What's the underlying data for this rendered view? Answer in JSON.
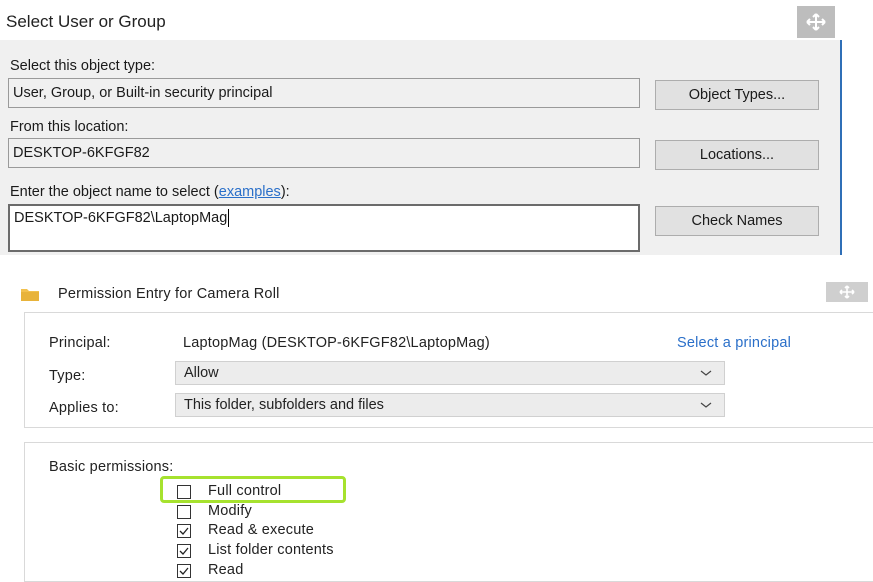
{
  "select_dialog": {
    "title": "Select User or Group",
    "object_type_label": "Select this object type:",
    "object_type_value": "User, Group, or Built-in security principal",
    "object_types_button": "Object Types...",
    "location_label": "From this location:",
    "location_value": "DESKTOP-6KFGF82",
    "locations_button": "Locations...",
    "enter_name_label_prefix": "Enter the object name to select (",
    "enter_name_link": "examples",
    "enter_name_label_suffix": "):",
    "object_name_value": "DESKTOP-6KFGF82\\LaptopMag",
    "check_names_button": "Check Names"
  },
  "permission_dialog": {
    "title": "Permission Entry for Camera Roll",
    "principal_label": "Principal:",
    "principal_value": "LaptopMag (DESKTOP-6KFGF82\\LaptopMag)",
    "select_principal_link": "Select a principal",
    "type_label": "Type:",
    "type_value": "Allow",
    "applies_to_label": "Applies to:",
    "applies_to_value": "This folder, subfolders and files",
    "basic_permissions_label": "Basic permissions:",
    "permissions": [
      {
        "label": "Full control",
        "checked": false
      },
      {
        "label": "Modify",
        "checked": false
      },
      {
        "label": "Read & execute",
        "checked": true
      },
      {
        "label": "List folder contents",
        "checked": true
      },
      {
        "label": "Read",
        "checked": true
      }
    ]
  },
  "colors": {
    "link": "#2a6fc9",
    "highlight": "#a6e22e",
    "dialog_bg": "#f0f0f0",
    "accent_border": "#2f6fb7"
  },
  "icons": [
    "move-arrows-icon",
    "folder-icon",
    "chevron-down-icon",
    "checkmark-icon"
  ]
}
